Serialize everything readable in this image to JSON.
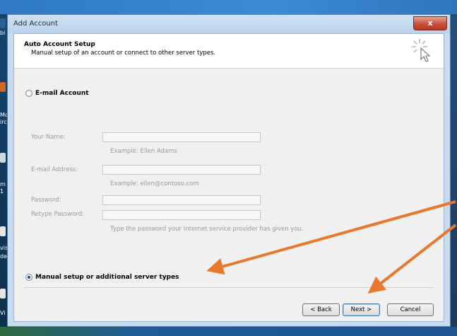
{
  "window": {
    "title": "Add Account",
    "close_glyph": "x"
  },
  "header": {
    "title": "Auto Account Setup",
    "subtitle": "Manual setup of an account or connect to other server types.",
    "icon": "wizard-cursor-icon"
  },
  "email_option": {
    "label": "E-mail Account",
    "selected": false
  },
  "fields": {
    "name_label": "Your Name:",
    "name_value": "",
    "name_hint": "Example: Ellen Adams",
    "email_label": "E-mail Address:",
    "email_value": "",
    "email_hint": "Example: ellen@contoso.com",
    "password_label": "Password:",
    "password_value": "",
    "retype_label": "Retype Password:",
    "retype_value": "",
    "password_hint": "Type the password your Internet service provider has given you."
  },
  "manual_option": {
    "label": "Manual setup or additional server types",
    "selected": true
  },
  "buttons": {
    "back": "< Back",
    "next": "Next >",
    "cancel": "Cancel"
  },
  "desktop": {
    "fragments": [
      "bi",
      "Mo",
      "irc",
      "m",
      "1",
      "vis",
      "de",
      "Vi"
    ]
  },
  "colors": {
    "annotation_arrow": "#e8782e",
    "close_button": "#c8503a",
    "window_frame": "#c7dcef"
  }
}
